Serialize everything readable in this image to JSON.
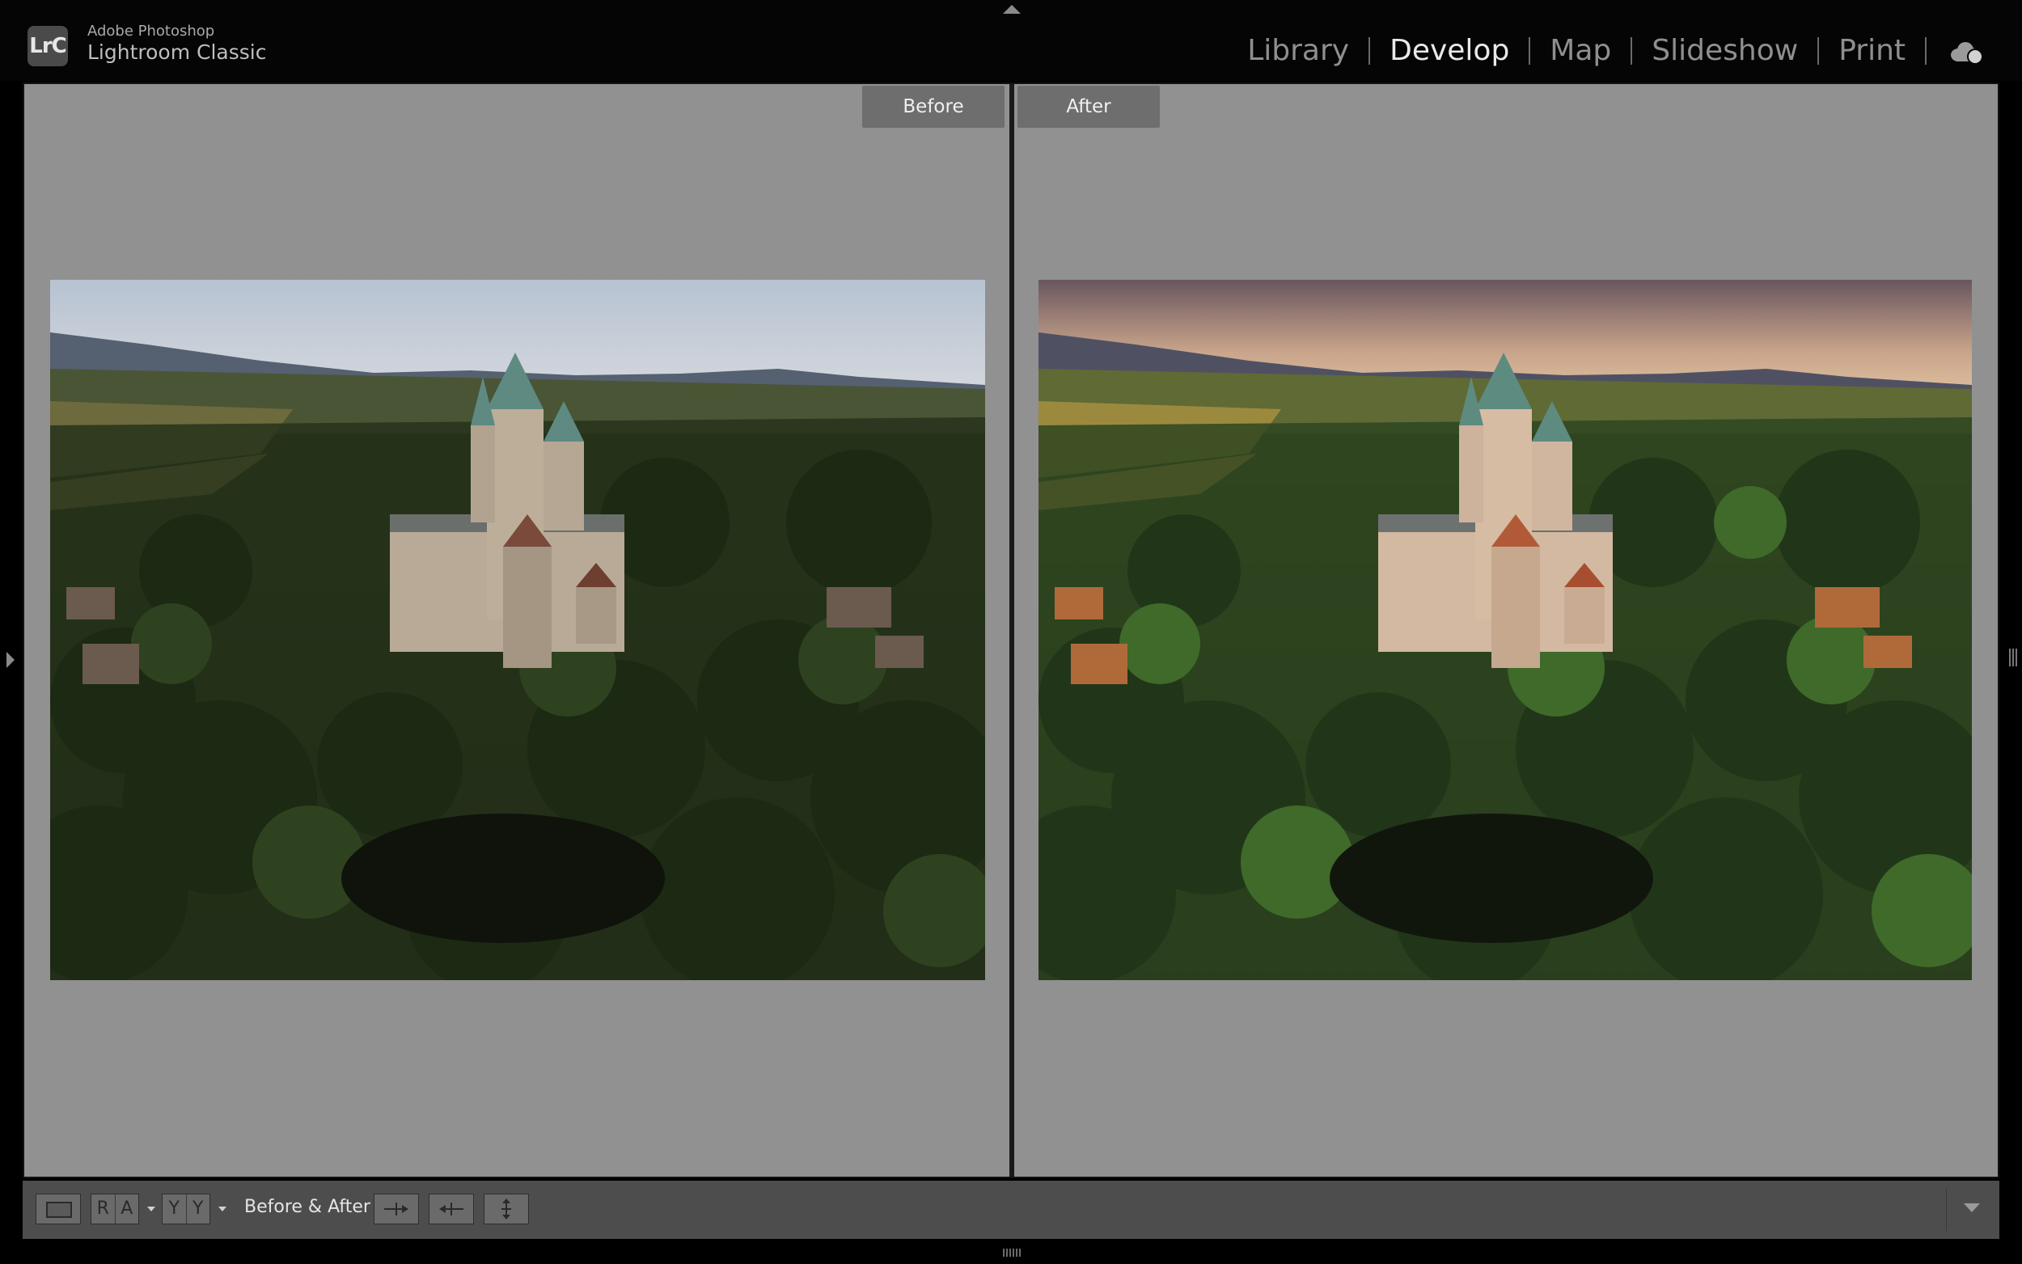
{
  "header": {
    "logo_text": "LrC",
    "vendor": "Adobe Photoshop",
    "app_name": "Lightroom Classic",
    "modules": [
      {
        "label": "Library",
        "active": false
      },
      {
        "label": "Develop",
        "active": true
      },
      {
        "label": "Map",
        "active": false
      },
      {
        "label": "Slideshow",
        "active": false
      },
      {
        "label": "Print",
        "active": false
      }
    ],
    "cloud_icon": "cloud-sync-icon"
  },
  "view": {
    "before_label": "Before",
    "after_label": "After",
    "photo_subject": "aerial view of a castle among forest"
  },
  "toolbar": {
    "loupe_icon": "loupe-view-icon",
    "ra_glyphs": [
      "R",
      "A"
    ],
    "yy_glyphs": [
      "Y",
      "Y"
    ],
    "before_after_label": "Before & After :",
    "buttons": [
      "copy-before-to-after",
      "copy-after-to-before",
      "swap-before-after"
    ]
  },
  "colors": {
    "pane_bg": "#919191",
    "toolbar_bg": "#4d4d4d",
    "active_module": "#e9e9e9",
    "inactive_module": "#8f8f8f"
  }
}
